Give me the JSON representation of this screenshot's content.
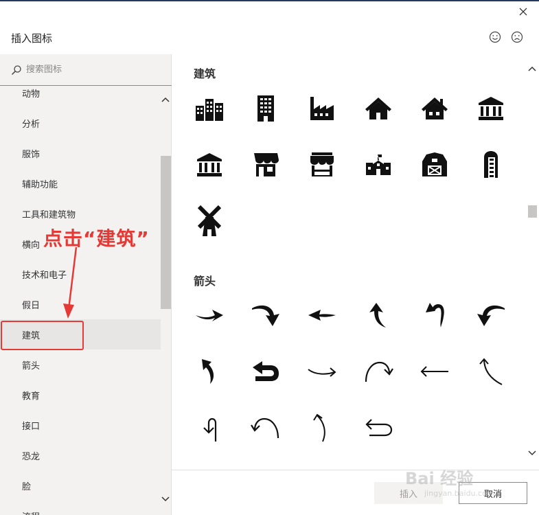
{
  "dialog": {
    "title": "插入图标",
    "close_icon": "close-icon"
  },
  "header_icons": [
    "smile-feedback-icon",
    "frown-feedback-icon"
  ],
  "search": {
    "placeholder": "搜索图标"
  },
  "categories": [
    {
      "label": "动物"
    },
    {
      "label": "分析"
    },
    {
      "label": "服饰"
    },
    {
      "label": "辅助功能"
    },
    {
      "label": "工具和建筑物"
    },
    {
      "label": "横向"
    },
    {
      "label": "技术和电子"
    },
    {
      "label": "假日"
    },
    {
      "label": "建筑",
      "selected": true
    },
    {
      "label": "箭头"
    },
    {
      "label": "教育"
    },
    {
      "label": "接口"
    },
    {
      "label": "恐龙"
    },
    {
      "label": "脸"
    },
    {
      "label": "流程"
    }
  ],
  "annotation": {
    "text": "点击“建筑”",
    "color": "#e53935"
  },
  "sections": [
    {
      "title": "建筑",
      "icons": [
        "office-buildings-icon",
        "office-tower-icon",
        "factory-icon",
        "house-icon",
        "house-chimney-icon",
        "bank-icon",
        "museum-icon",
        "storefront-icon",
        "shop-stall-icon",
        "school-icon",
        "barn-icon",
        "silo-icon",
        "windmill-icon"
      ]
    },
    {
      "title": "箭头",
      "icons": [
        "arrow-right-curved-icon",
        "arrow-curve-down-right-icon",
        "arrow-left-icon",
        "arrow-up-curved-icon",
        "arrow-turn-back-up-icon",
        "arrow-curve-down-left-icon",
        "arrow-up-left-curved-icon",
        "arrow-u-turn-left-icon",
        "arrow-right-thin-icon",
        "arrow-clockwise-thin-icon",
        "arrow-left-thin-icon",
        "arrow-up-left-thin-icon",
        "arrow-turn-left-thin-icon",
        "arrow-counterclockwise-thin-icon",
        "arrow-up-curved-thin-icon",
        "arrow-return-left-thin-icon"
      ]
    }
  ],
  "footer": {
    "insert_label": "插入",
    "cancel_label": "取消"
  },
  "watermark": {
    "text": "Bai 经验",
    "sub": "jingyan.baidu.com"
  },
  "colors": {
    "accent": "#243a5e",
    "annotation": "#e53935",
    "sidebar_bg": "#f3f2f1"
  }
}
